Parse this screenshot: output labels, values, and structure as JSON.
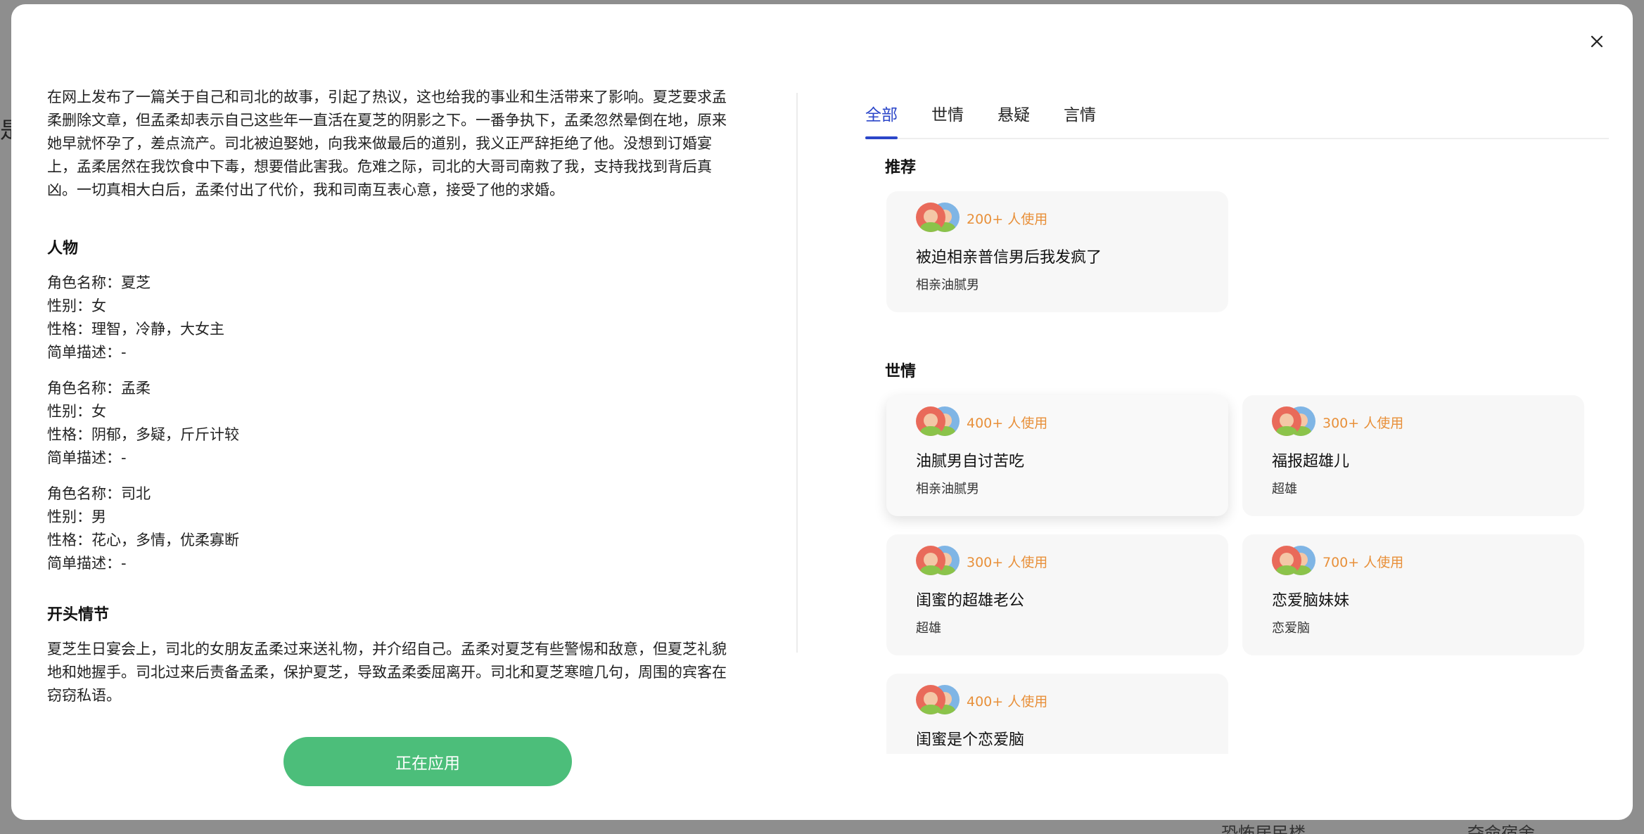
{
  "modal": {
    "synopsis": "在网上发布了一篇关于自己和司北的故事，引起了热议，这也给我的事业和生活带来了影响。夏芝要求孟柔删除文章，但孟柔却表示自己这些年一直活在夏芝的阴影之下。一番争执下，孟柔忽然晕倒在地，原来她早就怀孕了，差点流产。司北被迫娶她，向我来做最后的道别，我义正严辞拒绝了他。没想到订婚宴上，孟柔居然在我饮食中下毒，想要借此害我。危难之际，司北的大哥司南救了我，支持我找到背后真凶。一切真相大白后，孟柔付出了代价，我和司南互表心意，接受了他的求婚。",
    "characters_title": "人物",
    "characters": [
      {
        "name": "角色名称：夏芝",
        "gender": "性别：女",
        "personality": "性格：理智，冷静，大女主",
        "desc": "简单描述：-"
      },
      {
        "name": "角色名称：孟柔",
        "gender": "性别：女",
        "personality": "性格：阴郁，多疑，斤斤计较",
        "desc": "简单描述：-"
      },
      {
        "name": "角色名称：司北",
        "gender": "性别：男",
        "personality": "性格：花心，多情，优柔寡断",
        "desc": "简单描述：-"
      }
    ],
    "opening_title": "开头情节",
    "opening": "夏芝生日宴会上，司北的女朋友孟柔过来送礼物，并介绍自己。孟柔对夏芝有些警惕和敌意，但夏芝礼貌地和她握手。司北过来后责备孟柔，保护夏芝，导致孟柔委屈离开。司北和夏芝寒暄几句，周围的宾客在窃窃私语。",
    "apply_button": "正在应用",
    "tabs": [
      "全部",
      "世情",
      "悬疑",
      "言情"
    ],
    "groups": [
      {
        "title": "推荐",
        "cards": [
          {
            "usage": "200+ 人使用",
            "title": "被迫相亲普信男后我发疯了",
            "tag": "相亲油腻男"
          }
        ]
      },
      {
        "title": "世情",
        "cards": [
          {
            "usage": "400+ 人使用",
            "title": "油腻男自讨苦吃",
            "tag": "相亲油腻男"
          },
          {
            "usage": "300+ 人使用",
            "title": "福报超雄儿",
            "tag": "超雄"
          },
          {
            "usage": "300+ 人使用",
            "title": "闺蜜的超雄老公",
            "tag": "超雄"
          },
          {
            "usage": "700+ 人使用",
            "title": "恋爱脑妹妹",
            "tag": "恋爱脑"
          },
          {
            "usage": "400+ 人使用",
            "title": "闺蜜是个恋爱脑",
            "tag": ""
          }
        ]
      }
    ]
  },
  "background": {
    "left_char": "是",
    "bottom_texts": [
      "恐怖居民楼",
      "夺命宿舍"
    ]
  },
  "colors": {
    "accent": "#2b46c9",
    "apply_green": "#4cbe7a",
    "usage_orange": "#e8903a"
  }
}
